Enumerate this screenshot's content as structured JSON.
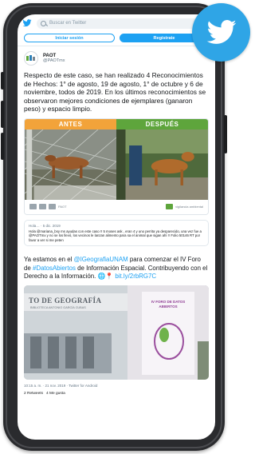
{
  "search": {
    "placeholder": "Buscar en Twitter"
  },
  "auth": {
    "login": "Iniciar sesión",
    "register": "Regístrate"
  },
  "tweet": {
    "name": "PAOT",
    "handle": "@PAOTmx",
    "text": "Respecto de este caso, se han realizado 4 Reconocimientos de Hechos: 1° de agosto, 19 de agosto, 1° de octubre y 6 de noviembre, todos de 2019. En los últimos reconocimientos se observaron mejores condiciones de ejemplares (ganaron peso) y espacio limpio.",
    "label_before": "ANTES",
    "label_after": "DESPUÉS",
    "logo_left_text": "PAOT",
    "logo_right_text": "vigilancia ambiental",
    "quote_header": "Hola… · 5 dic. 2019",
    "quote_text": "Hola @mariana_bsy ms ayudas con este caso !! 5 moses ask , eran 4 y uno perrita ya desparecido, una vez fue a @PAOTmx y no se los llevó, los vecinos le lanzan alimento para sa el animal que sigan ahí !! Folio 50146 RT por favor a ver si me peten"
  },
  "tweet2": {
    "text_before_mention": "Ya estamos en el ",
    "mention": "@IGeografiaUNAM",
    "text_mid": " para comenzar el IV Foro de ",
    "hashtag": "#DatosAbiertos",
    "text_after": " de Información Espacial. Contribuyendo con el Derecho a la Información. 🌐📍 ",
    "link": "bit.ly/2rbRG7C",
    "banner_sign": "TO DE GEOGRAFÍA",
    "banner_sub": "BIBLIOTECA ANTONIO GARCÍA CUBAS",
    "poster_title": "IV FORO DE DATOS ABIERTOS",
    "timestamp": "10:15 a. m. · 21 nov. 2019 · Twitter for Android",
    "retweets": "2 Retweets",
    "likes": "4 Me gusta"
  },
  "colors": {
    "twitter_blue": "#1da1f2",
    "badge": "#2fa5e6",
    "antes": "#f2a33a",
    "despues": "#5ea53c"
  },
  "icons": [
    "twitter-bird-icon",
    "search-icon",
    "globe-icon",
    "pin-icon"
  ]
}
